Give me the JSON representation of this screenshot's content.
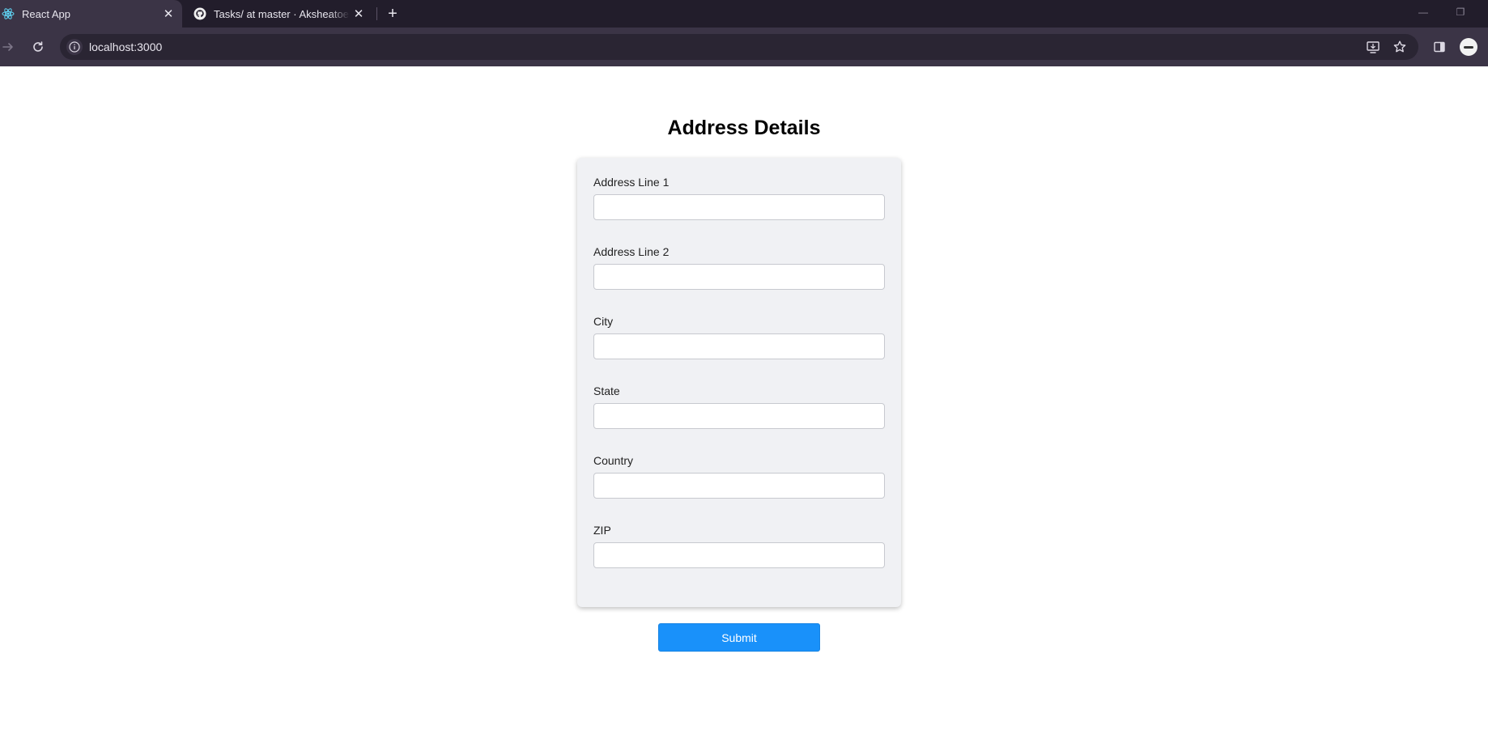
{
  "browser": {
    "tabs": [
      {
        "title": "React App",
        "active": true
      },
      {
        "title": "Tasks/ at master · Aksheatoes/Tasks",
        "active": false
      }
    ],
    "close_glyph": "✕",
    "new_tab_glyph": "+",
    "minimize_glyph": "—",
    "restore_glyph": "❐",
    "url": "localhost:3000"
  },
  "page": {
    "title": "Address Details",
    "fields": [
      {
        "label": "Address Line 1",
        "value": ""
      },
      {
        "label": "Address Line 2",
        "value": ""
      },
      {
        "label": "City",
        "value": ""
      },
      {
        "label": "State",
        "value": ""
      },
      {
        "label": "Country",
        "value": ""
      },
      {
        "label": "ZIP",
        "value": ""
      }
    ],
    "submit_label": "Submit"
  },
  "colors": {
    "tab_strip": "#221d2b",
    "toolbar": "#3b3446",
    "card_background": "#f0f1f4",
    "submit_button": "#1991fa"
  }
}
